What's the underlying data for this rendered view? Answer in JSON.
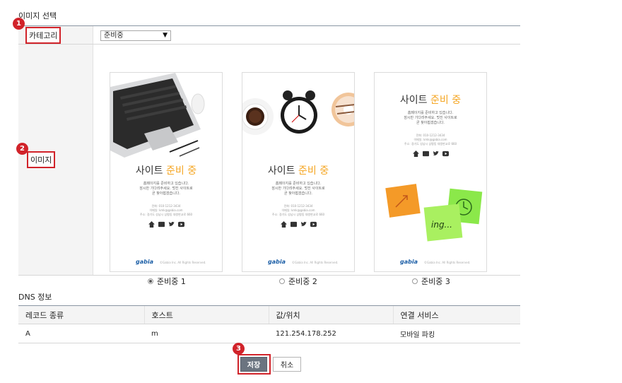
{
  "sections": {
    "image_title": "이미지 선택",
    "dns_title": "DNS 정보"
  },
  "badges": [
    "1",
    "2",
    "3"
  ],
  "form": {
    "category_label": "카테고리",
    "category_value": "준비중",
    "image_label": "이미지"
  },
  "cards": [
    {
      "title_main": "사이트",
      "title_accent": "준비 중",
      "line1": "홈페이지를 준비하고 있습니다.",
      "line2": "잠시만 기다려주세요. 멋진 사이트로",
      "line3": "곧 찾아뵙겠습니다.",
      "contact1": "전화: 010-1212-3434",
      "contact2": "이메일: kmk@gabia.com",
      "contact3": "주소: 경기도 성남시 삼평동 대왕판교로 660",
      "logo": "gabia",
      "copyright": "©Gabia Inc. All Rights Reserved.",
      "radio_label": "준비중 1",
      "checked": true
    },
    {
      "title_main": "사이트",
      "title_accent": "준비 중",
      "line1": "홈페이지를 준비하고 있습니다.",
      "line2": "잠시만 기다려주세요. 멋진 사이트로",
      "line3": "곧 찾아뵙겠습니다.",
      "contact1": "전화: 010-1212-3434",
      "contact2": "이메일: kmk@gabia.com",
      "contact3": "주소: 경기도 성남시 삼평동 대왕판교로 660",
      "logo": "gabia",
      "copyright": "©Gabia Inc. All Rights Reserved.",
      "radio_label": "준비중 2",
      "checked": false
    },
    {
      "title_main": "사이트",
      "title_accent": "준비 중",
      "line1": "홈페이지를 준비하고 있습니다.",
      "line2": "잠시만 기다려주세요. 멋진 사이트로",
      "line3": "곧 찾아뵙겠습니다.",
      "contact1": "전화: 010-1212-3434",
      "contact2": "이메일: kmk@gabia.com",
      "contact3": "주소: 경기도 성남시 삼평동 대왕판교로 660",
      "logo": "gabia",
      "copyright": "©Gabia Inc. All Rights Reserved.",
      "sticky_text": "ing...",
      "radio_label": "준비중 3",
      "checked": false
    }
  ],
  "dns": {
    "headers": [
      "레코드 종류",
      "호스트",
      "값/위치",
      "연결 서비스"
    ],
    "rows": [
      [
        "A",
        "m",
        "121.254.178.252",
        "모바일 파킹"
      ]
    ]
  },
  "buttons": {
    "save": "저장",
    "cancel": "취소"
  },
  "colors": {
    "highlight": "#d1232a",
    "accent": "#f5a623",
    "save_button": "#6b7480"
  }
}
